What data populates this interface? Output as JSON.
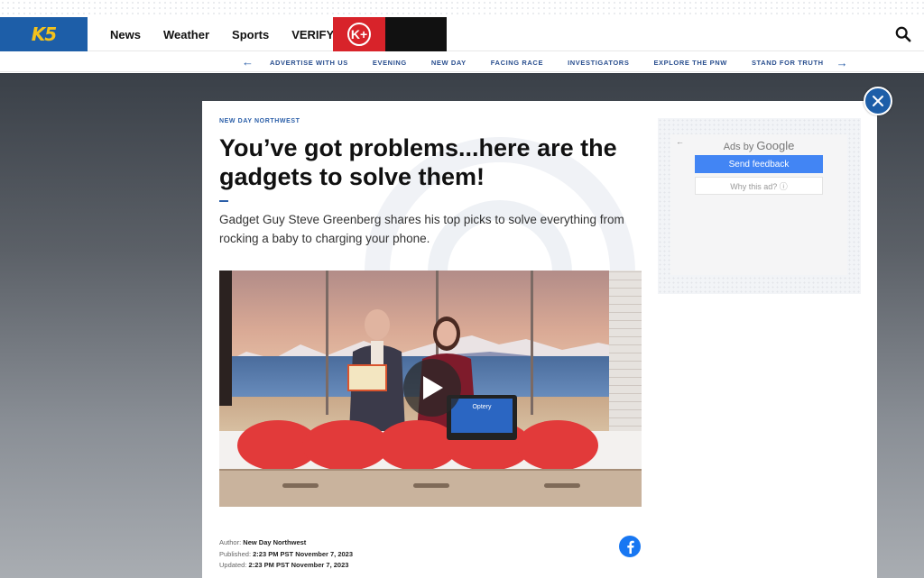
{
  "header": {
    "logo_text": "K5",
    "nav": [
      "News",
      "Weather",
      "Sports",
      "VERIFY"
    ],
    "kplus_label": "K+"
  },
  "subnav": {
    "items": [
      "ADVERTISE WITH US",
      "EVENING",
      "NEW DAY",
      "FACING RACE",
      "INVESTIGATORS",
      "EXPLORE THE PNW",
      "STAND FOR TRUTH"
    ]
  },
  "article": {
    "kicker": "NEW DAY NORTHWEST",
    "headline": "You’ve got problems...here are the gadgets to solve them!",
    "dek": "Gadget Guy Steve Greenberg shares his top picks to solve everything from rocking a baby to charging your phone.",
    "video_screen_text": "Optery",
    "byline": {
      "author_label": "Author:",
      "author": "New Day Northwest",
      "published_label": "Published:",
      "published": "2:23 PM PST November 7, 2023",
      "updated_label": "Updated:",
      "updated": "2:23 PM PST November 7, 2023"
    }
  },
  "ad": {
    "ads_by": "Ads by",
    "google": "Google",
    "send_feedback": "Send feedback",
    "why_this_ad": "Why this ad? ⓘ"
  },
  "colors": {
    "brand_blue": "#1d5ea8",
    "accent_red": "#d8232a",
    "facebook": "#1877f2"
  }
}
